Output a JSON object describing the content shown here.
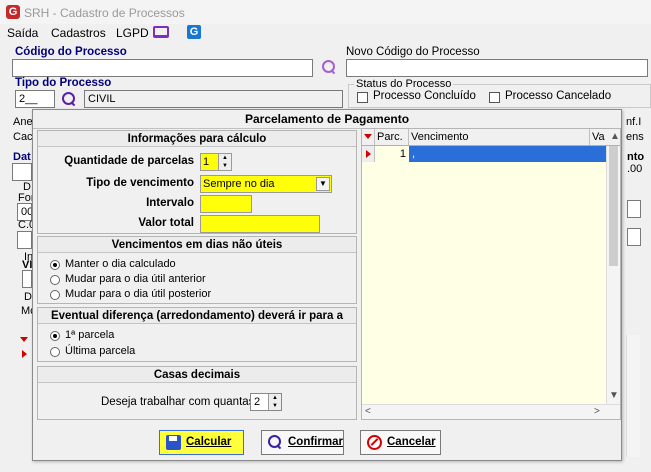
{
  "window": {
    "title": "SRH - Cadastro de Processos"
  },
  "menu": {
    "items": [
      "Saída",
      "Cadastros",
      "LGPD"
    ]
  },
  "form": {
    "codigo_label": "Código do Processo",
    "codigo_value": "",
    "novo_codigo_label": "Novo Código do Processo",
    "novo_codigo_value": "",
    "tipo_label": "Tipo do Processo",
    "tipo_code": "2__",
    "tipo_desc": "CIVIL",
    "status_label": "Status do Processo",
    "status_concluido": "Processo Concluído",
    "status_cancelado": "Processo Cancelado"
  },
  "background_fragments": {
    "ane": "Ane",
    "cad": "Cac",
    "dat": "Dat",
    "d1": "D",
    "for": "For",
    "n00": "00",
    "c0": "C.0",
    "in": "In",
    "vi": "VI",
    "d2": "D",
    "mo": "Mc",
    "nf": "nf.I",
    "ens": "ens",
    "nto": "nto",
    "n00b": ".00"
  },
  "dialog": {
    "title": "Parcelamento de Pagamento",
    "info": {
      "header": "Informações para cálculo",
      "qtd_label": "Quantidade de parcelas",
      "qtd_value": "1",
      "tipo_label": "Tipo de vencimento",
      "tipo_value": "Sempre no dia",
      "intervalo_label": "Intervalo",
      "intervalo_value": "",
      "valor_label": "Valor total",
      "valor_value": ""
    },
    "naouteis": {
      "header": "Vencimentos em dias não úteis",
      "options": [
        "Manter o dia calculado",
        "Mudar para o dia útil anterior",
        "Mudar para o dia útil posterior"
      ]
    },
    "diferenca": {
      "header": "Eventual diferença (arredondamento) deverá ir para a",
      "options": [
        "1ª parcela",
        "Última parcela"
      ]
    },
    "casas": {
      "header": "Casas decimais",
      "label": "Deseja trabalhar com quantas",
      "value": "2"
    },
    "grid": {
      "columns": [
        "Parc.",
        "Vencimento",
        "Va"
      ],
      "rows": [
        {
          "parc": "1",
          "venc": ","
        }
      ]
    },
    "buttons": {
      "calcular": "Calcular",
      "confirmar": "Confirmar",
      "cancelar": "Cancelar"
    }
  },
  "colors": {
    "highlight_yellow": "#ffff0a",
    "selection_blue": "#2a6fd8",
    "accent_red": "#d10000",
    "label_blue": "#00007a"
  }
}
